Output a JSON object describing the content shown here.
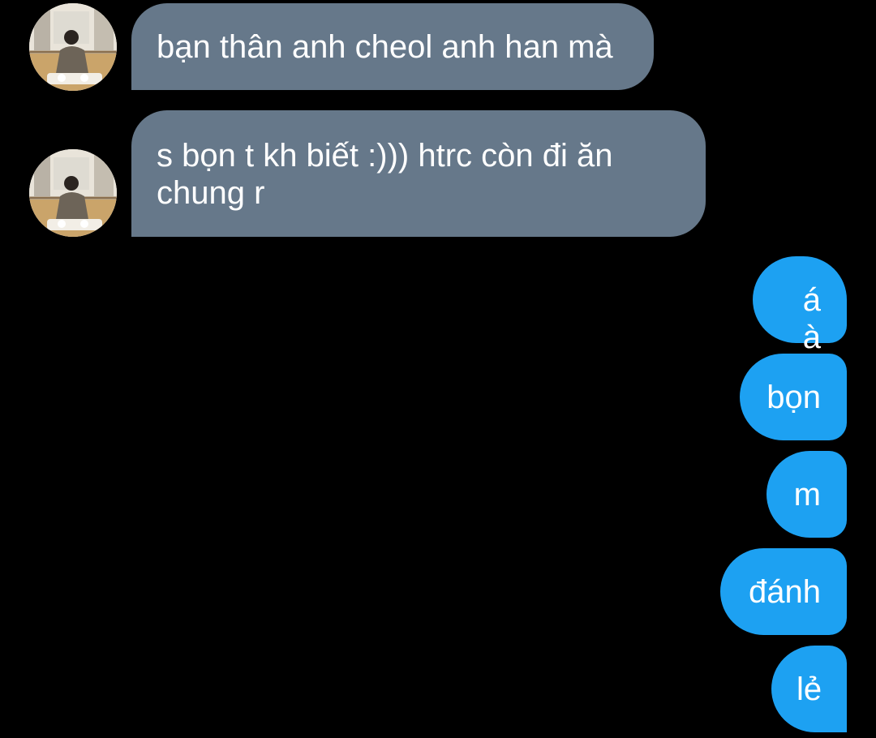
{
  "conversation": {
    "contact_avatar": "avatar-icon",
    "colors": {
      "background": "#000000",
      "incoming_bubble": "#66788a",
      "outgoing_bubble": "#1da1f2",
      "text": "#ffffff"
    },
    "messages": [
      {
        "direction": "incoming",
        "text": "bạn thân anh cheol anh han mà"
      },
      {
        "direction": "incoming",
        "text": "s bọn t kh biết :))) htrc còn đi ăn chung r"
      },
      {
        "direction": "outgoing",
        "text": "á à"
      },
      {
        "direction": "outgoing",
        "text": "bọn"
      },
      {
        "direction": "outgoing",
        "text": "m"
      },
      {
        "direction": "outgoing",
        "text": "đánh"
      },
      {
        "direction": "outgoing",
        "text": "lẻ"
      }
    ]
  }
}
